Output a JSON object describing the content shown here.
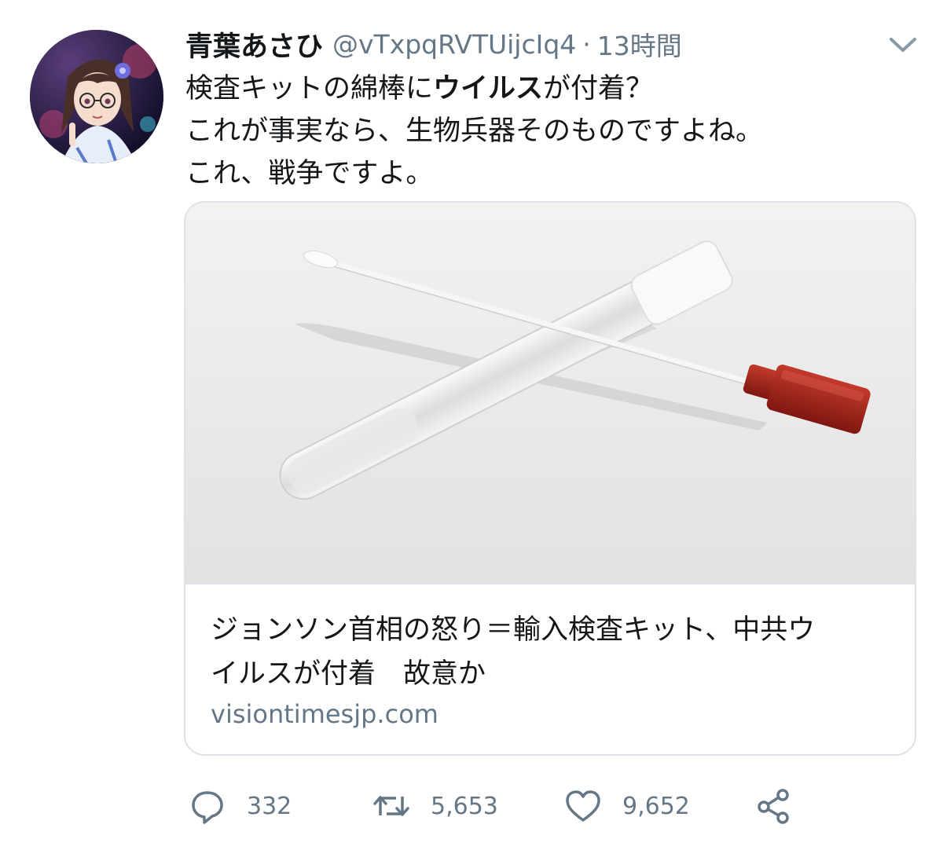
{
  "user": {
    "name": "青葉あさひ",
    "handle": "@vTxpqRVTUijcIq4",
    "separator": "·",
    "time": "13時間"
  },
  "tweet": {
    "line1_before": "検査キットの綿棒に",
    "line1_bold": "ウイルス",
    "line1_after": "が付着？",
    "line2": "これが事実なら、生物兵器そのものですよね。",
    "line3": "これ、戦争ですよ。"
  },
  "card": {
    "title_line1": "ジョンソン首相の怒り＝輸入検査キット、中共ウ",
    "title_line2": "イルスが付着　故意か",
    "domain": "visiontimesjp.com"
  },
  "actions": {
    "reply_count": "332",
    "retweet_count": "5,653",
    "like_count": "9,652"
  },
  "icons": {
    "more": "chevron-down-icon",
    "reply": "reply-icon",
    "retweet": "retweet-icon",
    "like": "heart-icon",
    "share": "share-icon"
  },
  "colors": {
    "text": "#14171a",
    "secondary": "#657786",
    "border": "#dde3e8"
  }
}
